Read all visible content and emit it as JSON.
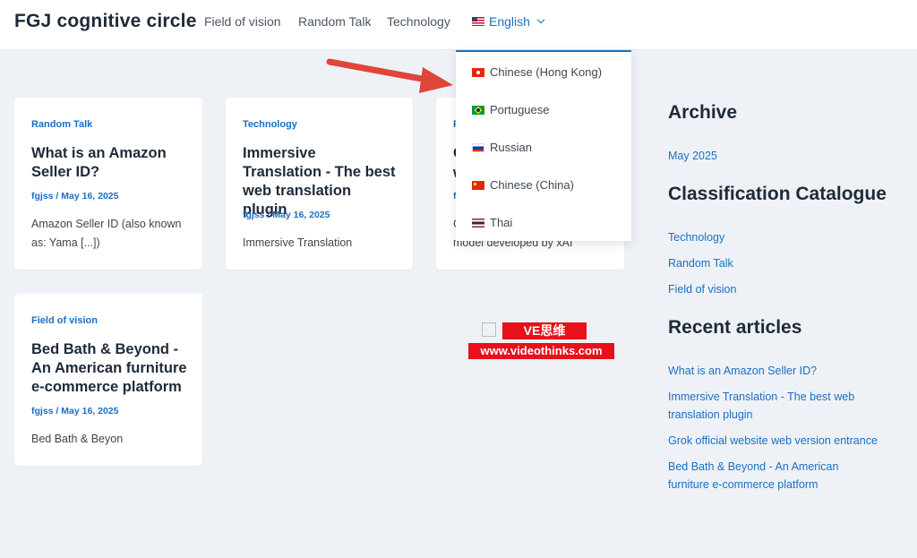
{
  "header": {
    "site_title": "FGJ cognitive circle",
    "nav": [
      "Field of vision",
      "Random Talk",
      "Technology"
    ],
    "language": "English"
  },
  "language_menu": {
    "items": [
      {
        "label": "Chinese (Hong Kong)",
        "flag": "hk-flag"
      },
      {
        "label": "Portuguese",
        "flag": "br-flag"
      },
      {
        "label": "Russian",
        "flag": "ru-flag"
      },
      {
        "label": "Chinese (China)",
        "flag": "cn-flag"
      },
      {
        "label": "Thai",
        "flag": "th-flag"
      }
    ]
  },
  "posts": [
    {
      "category": "Random Talk",
      "title": "What is an Amazon Seller ID?",
      "meta": "fgjss / May 16, 2025",
      "excerpt": "Amazon Seller ID (also known as: Yama [...])"
    },
    {
      "category": "Technology",
      "title": "Immersive Translation - The best web translation plugin",
      "meta": "fgjss / May 16, 2025",
      "excerpt": "Immersive Translation"
    },
    {
      "category": "F",
      "title": "G",
      "title2": "w",
      "meta": "f",
      "excerpt": "model developed by xAI",
      "excerpt_prefix": "G"
    },
    {
      "category": "Field of vision",
      "title": "Bed Bath & Beyond - An American furniture e-commerce platform",
      "meta": "fgjss / May 16, 2025",
      "excerpt": "Bed Bath & Beyon"
    }
  ],
  "sidebar": {
    "archive_heading": "Archive",
    "archive_items": [
      "May 2025"
    ],
    "catalogue_heading": "Classification Catalogue",
    "catalogue_items": [
      "Technology",
      "Random Talk",
      "Field of vision"
    ],
    "recent_heading": "Recent articles",
    "recent_items": [
      "What is an Amazon Seller ID?",
      "Immersive Translation - The best web translation plugin",
      "Grok official website web version entrance",
      "Bed Bath & Beyond - An American furniture e-commerce platform"
    ]
  },
  "watermark": {
    "top": "VE思维",
    "bottom": "www.videothinks.com"
  },
  "colors": {
    "accent": "#1a6fc4",
    "background": "#eef2f6",
    "annotation_arrow": "#e0453a",
    "watermark": "#e8101a"
  }
}
